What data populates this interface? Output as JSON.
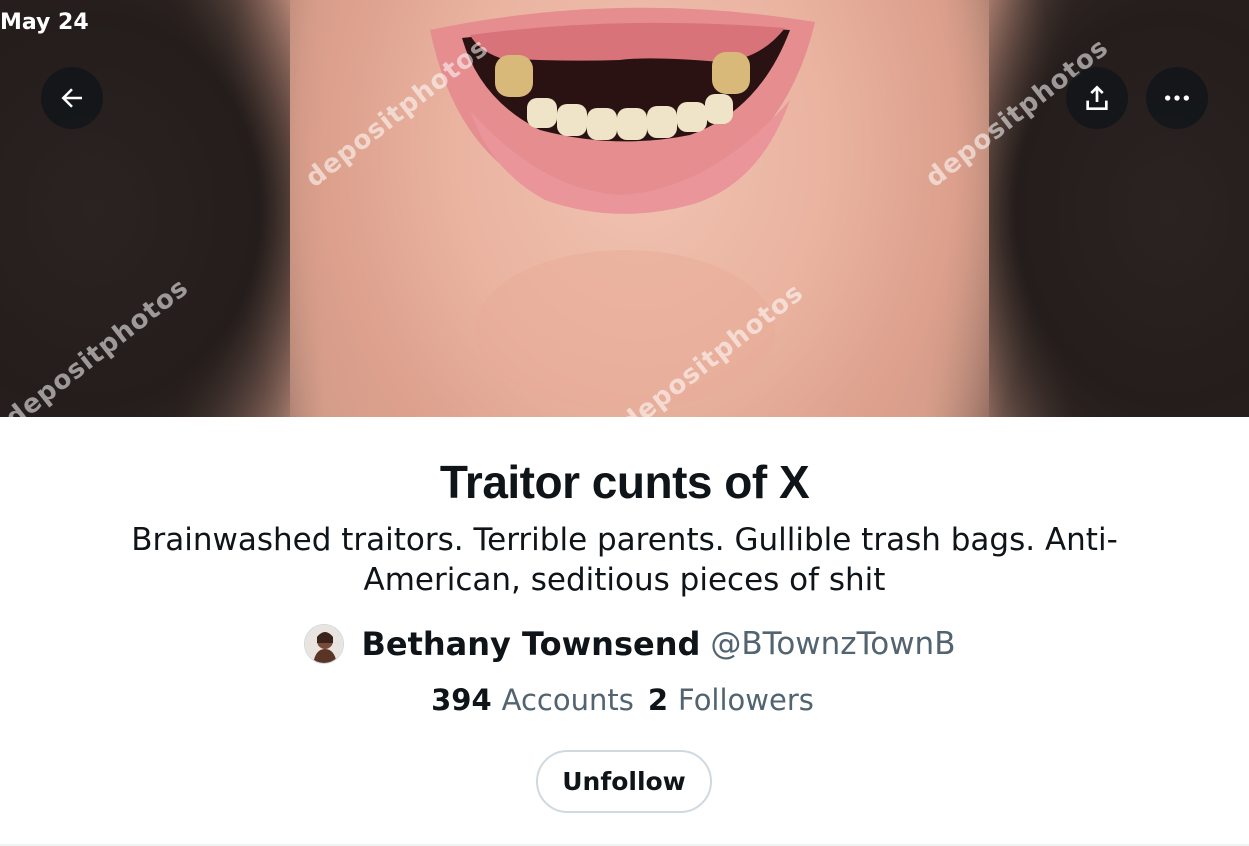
{
  "status_bar": {
    "date": "May 24"
  },
  "banner": {
    "watermark_text": "depositphotos"
  },
  "header": {
    "back_icon": "arrow-left-icon",
    "share_icon": "share-upload-icon",
    "more_icon": "ellipsis-horizontal-icon"
  },
  "list": {
    "title": "Traitor cunts of X",
    "description": "Brainwashed traitors. Terrible parents. Gullible trash bags. Anti-American, seditious pieces of shit",
    "owner": {
      "name": "Bethany Townsend",
      "handle": "@BTownzTownB"
    },
    "stats": {
      "accounts_count": "394",
      "accounts_label": "Accounts",
      "followers_count": "2",
      "followers_label": "Followers"
    },
    "unfollow_label": "Unfollow"
  },
  "colors": {
    "text_primary": "#0f1419",
    "text_secondary": "#536471",
    "border": "#cfd9de"
  }
}
